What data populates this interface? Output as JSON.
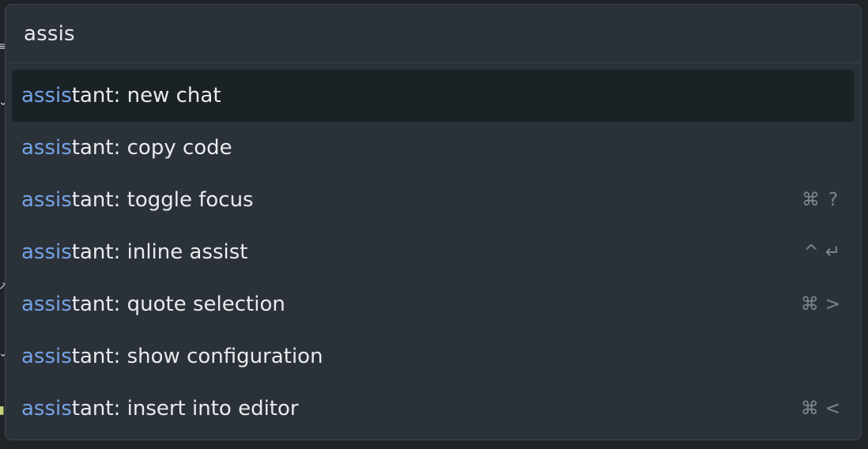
{
  "query": {
    "value": "assis"
  },
  "colors": {
    "match_highlight": "#74a3e6",
    "selected_row_bg": "#1b2226",
    "panel_bg": "#2b3138"
  },
  "results": [
    {
      "match": "assis",
      "rest": "tant: new chat",
      "shortcut": []
    },
    {
      "match": "assis",
      "rest": "tant: copy code",
      "shortcut": []
    },
    {
      "match": "assis",
      "rest": "tant: toggle focus",
      "shortcut": [
        "⌘",
        "?"
      ]
    },
    {
      "match": "assis",
      "rest": "tant: inline assist",
      "shortcut": [
        "^",
        "↵"
      ]
    },
    {
      "match": "assis",
      "rest": "tant: quote selection",
      "shortcut": [
        "⌘",
        ">"
      ]
    },
    {
      "match": "assis",
      "rest": "tant: show configuration",
      "shortcut": []
    },
    {
      "match": "assis",
      "rest": "tant: insert into editor",
      "shortcut": [
        "⌘",
        "<"
      ]
    }
  ]
}
